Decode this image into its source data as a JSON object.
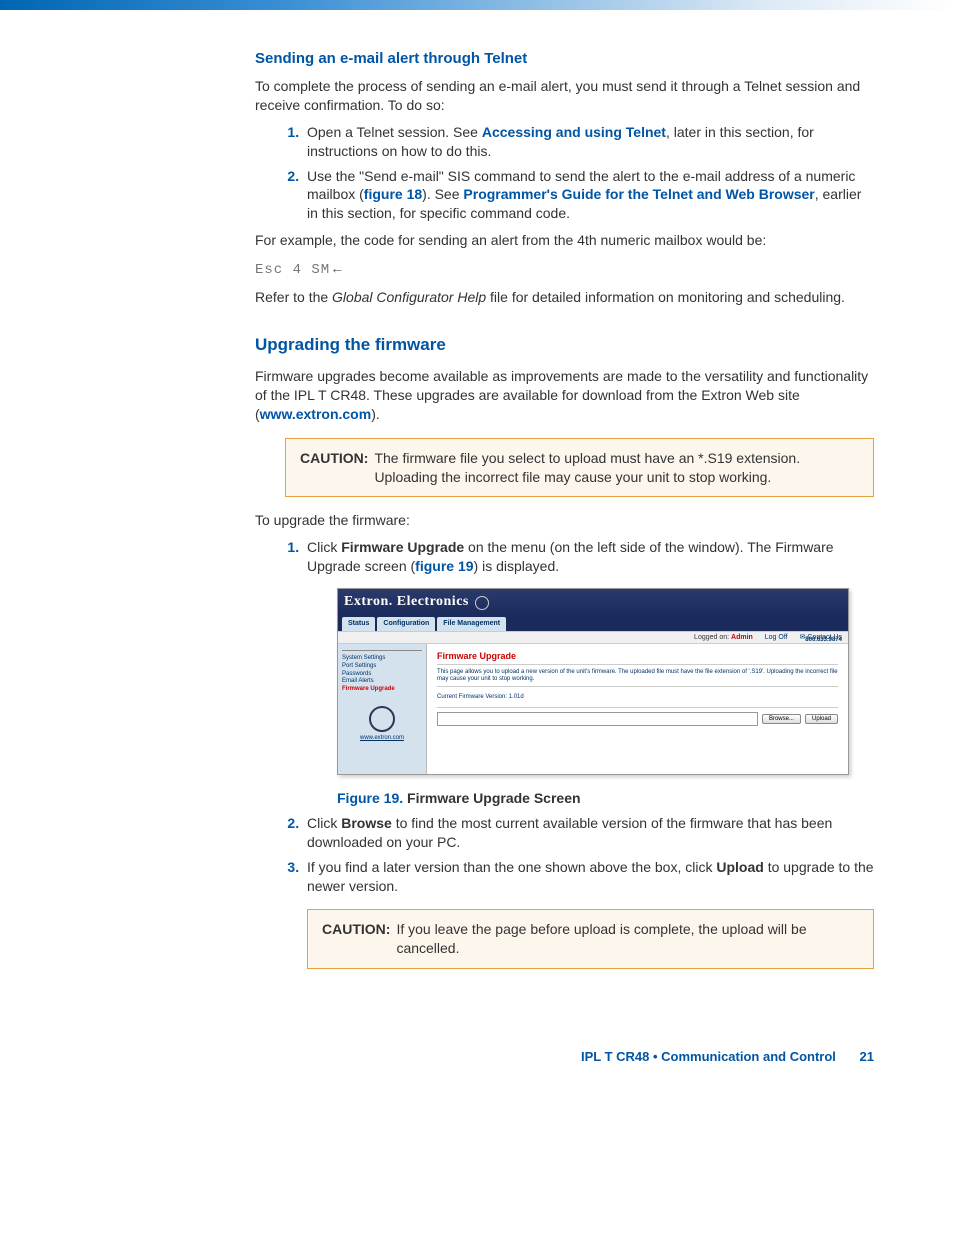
{
  "section1": {
    "heading": "Sending an e-mail alert through Telnet",
    "intro": "To complete the process of sending an e-mail alert, you must send it through a Telnet session and receive confirmation. To do so:",
    "step1_a": "Open a Telnet session. See ",
    "step1_link": "Accessing and using Telnet",
    "step1_b": ", later in this section, for instructions on how to do this.",
    "step2_a": "Use the \"Send e-mail\" SIS command to send the alert to the e-mail address of a numeric mailbox (",
    "step2_link1": "figure 18",
    "step2_b": "). See ",
    "step2_link2": "Programmer's Guide for the Telnet and Web Browser",
    "step2_c": ", earlier in this section, for specific command code.",
    "p3": "For example, the code for sending an alert from the 4th numeric mailbox would be:",
    "code": "Esc 4 SM",
    "p4_a": "Refer to the ",
    "p4_i": "Global Configurator Help",
    "p4_b": " file for detailed information on monitoring and scheduling."
  },
  "section2": {
    "heading": "Upgrading the firmware",
    "p1_a": "Firmware upgrades become available as improvements are made to the versatility and functionality of the IPL T CR48. These upgrades are available for download from the Extron Web site (",
    "p1_link": "www.extron.com",
    "p1_b": ").",
    "caution1_label": "CAUTION:",
    "caution1_text": "The firmware file you select to upload must have an *.S19 extension. Uploading the incorrect file may cause your unit to stop working.",
    "p2": "To upgrade the firmware:",
    "step1_a": "Click ",
    "step1_bold": "Firmware Upgrade",
    "step1_b": " on the menu (on the left side of the window). The Firmware Upgrade screen (",
    "step1_link": "figure 19",
    "step1_c": ") is displayed.",
    "fig19_num": "Figure 19.",
    "fig19_title": " Firmware Upgrade Screen",
    "step2_a": "Click ",
    "step2_bold": "Browse",
    "step2_b": " to find the most current available version of the firmware that has been downloaded on your PC.",
    "step3_a": "If you find a later version than the one shown above the box, click ",
    "step3_bold": "Upload",
    "step3_b": " to upgrade to the newer version.",
    "caution2_label": "CAUTION:",
    "caution2_text": "If you leave the page before upload is complete, the upload will be cancelled."
  },
  "screenshot": {
    "brand": "Extron. Electronics",
    "tabs": [
      "Status",
      "Configuration",
      "File Management"
    ],
    "phone": "800.633.9874",
    "logged_text": "Logged on: ",
    "logged_user": "Admin",
    "logoff": "Log Off",
    "contact": "Contact Us",
    "side_items": [
      "System Settings",
      "Port Settings",
      "Passwords",
      "Email Alerts",
      "Firmware Upgrade"
    ],
    "side_link": "www.extron.com",
    "panel_title": "Firmware Upgrade",
    "panel_desc": "This page allows you to upload a new version of the unit's firmware. The uploaded file must have the file extension of '.S19'. Uploading the incorrect file may cause your unit to stop working.",
    "panel_ver": "Current Firmware Version: 1.01d",
    "browse": "Browse...",
    "upload": "Upload"
  },
  "footer": {
    "text": "IPL T CR48 • Communication and Control",
    "page": "21"
  }
}
